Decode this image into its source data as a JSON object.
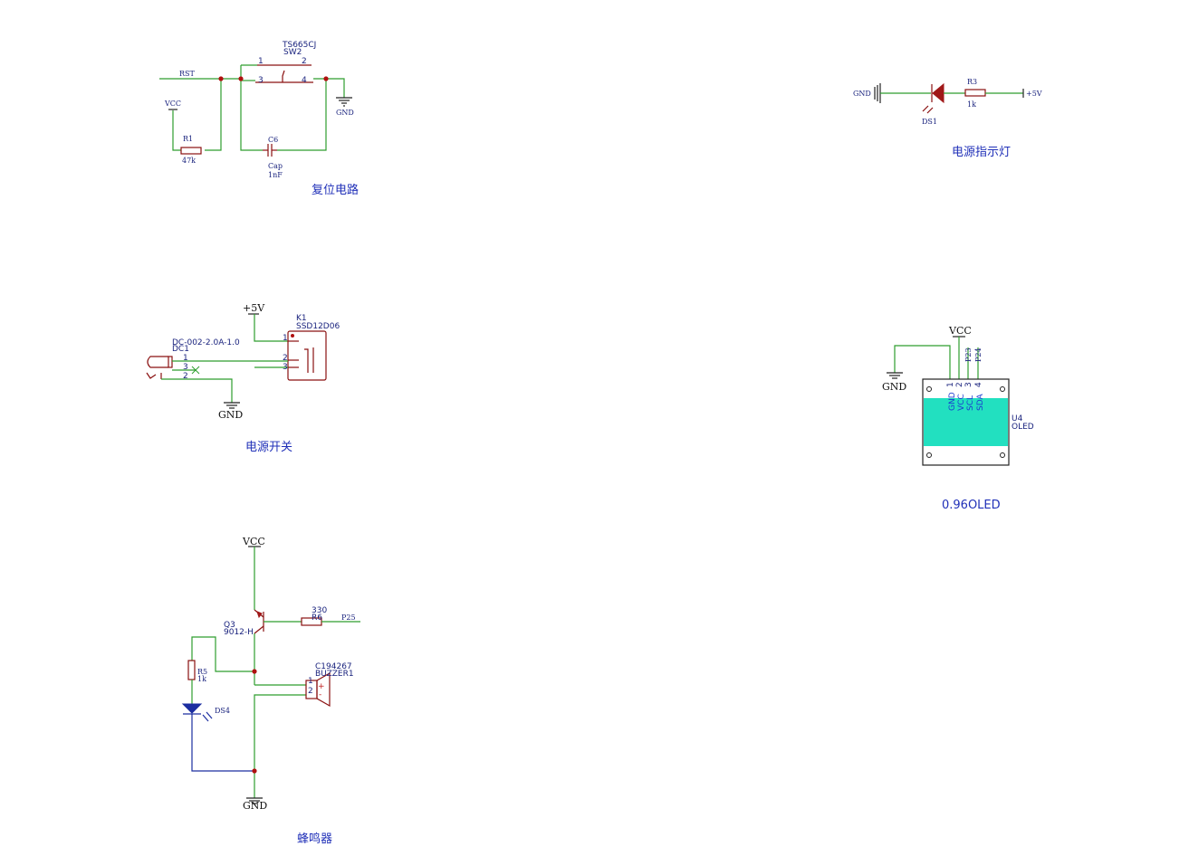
{
  "reset": {
    "title": "复位电路",
    "net_rst": "RST",
    "vcc": "VCC",
    "gnd": "GND",
    "r1_ref": "R1",
    "r1_val": "47k",
    "sw_part": "TS665CJ",
    "sw_ref": "SW2",
    "sw_pins": [
      "1",
      "2",
      "3",
      "4"
    ],
    "c6_ref": "C6",
    "c6_type": "Cap",
    "c6_val": "1nF"
  },
  "power_led": {
    "title": "电源指示灯",
    "gnd": "GND",
    "r3_ref": "R3",
    "r3_val": "1k",
    "v5": "+5V",
    "ds1_ref": "DS1"
  },
  "power_switch": {
    "title": "电源开关",
    "v5": "+5V",
    "k1_ref": "K1",
    "k1_part": "SSD12D06",
    "dc_part": "DC-002-2.0A-1.0",
    "dc_ref": "DC1",
    "dc_pins": [
      "1",
      "3",
      "2"
    ],
    "k1_pins": [
      "1",
      "2",
      "3"
    ],
    "gnd": "GND"
  },
  "oled": {
    "title": "0.96OLED",
    "vcc": "VCC",
    "gnd": "GND",
    "net_p23": "P23",
    "net_p24": "P24",
    "pin_names": [
      "GND",
      "VCC",
      "SCL",
      "SDA"
    ],
    "pin_nums": [
      "1",
      "2",
      "3",
      "4"
    ],
    "ref": "U4",
    "part": "OLED"
  },
  "buzzer": {
    "title": "蜂鸣器",
    "vcc": "VCC",
    "gnd": "GND",
    "q3_ref": "Q3",
    "q3_part": "9012-H",
    "r6_val": "330",
    "r6_ref": "R6",
    "net_p25": "P25",
    "r5_ref": "R5",
    "r5_val": "1k",
    "ds4_ref": "DS4",
    "bz_part": "C194267",
    "bz_ref": "BUZZER1",
    "bz_pins": [
      "1",
      "2"
    ],
    "bz_plus": "+",
    "bz_minus": "-"
  },
  "colors": {
    "wire": "#2e9e2e",
    "component": "#8a1010",
    "junction": "#b01010",
    "label": "#1a237e",
    "title": "#2030b8",
    "oled_screen": "#22e0c0"
  }
}
